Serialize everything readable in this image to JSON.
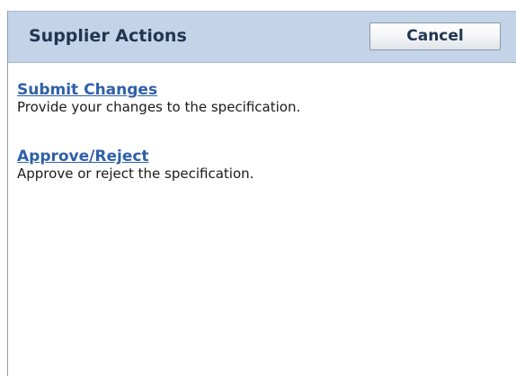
{
  "header": {
    "title": "Supplier Actions",
    "cancel_label": "Cancel"
  },
  "actions": [
    {
      "link": "Submit Changes",
      "description": "Provide your changes to the specification."
    },
    {
      "link": "Approve/Reject",
      "description": "Approve or reject the specification."
    }
  ],
  "colors": {
    "header_background": "#c4d4e8",
    "title_text": "#1f3550",
    "link": "#2f60a8",
    "body_text": "#1a1a1a"
  }
}
